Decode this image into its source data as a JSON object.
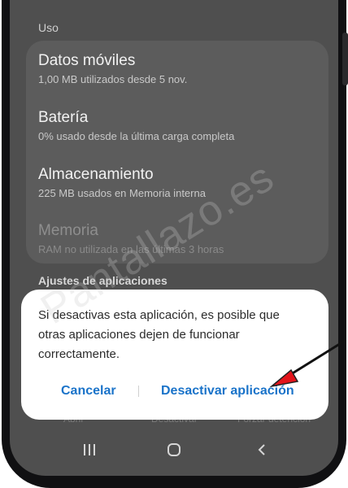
{
  "sections": {
    "usage_label": "Uso",
    "app_settings_label": "Ajustes de aplicaciones"
  },
  "usage_items": [
    {
      "title": "Datos móviles",
      "subtitle": "1,00 MB utilizados desde 5 nov."
    },
    {
      "title": "Batería",
      "subtitle": "0% usado desde la última carga completa"
    },
    {
      "title": "Almacenamiento",
      "subtitle": "225 MB usados en Memoria interna"
    },
    {
      "title": "Memoria",
      "subtitle": "RAM no utilizada en las últimas 3 horas"
    }
  ],
  "background_actions": {
    "open": "Abrir",
    "deactivate": "Desactivar",
    "force_stop": "Forzar detención"
  },
  "dialog": {
    "message": "Si desactivas esta aplicación, es posible que otras aplicaciones dejen de funcionar correctamente.",
    "cancel_label": "Cancelar",
    "deactivate_label": "Desactivar aplicación"
  },
  "navigation": {
    "recents_icon": "recents-icon",
    "home_icon": "home-icon",
    "back_icon": "back-icon"
  },
  "watermark": "Pantallazo.es",
  "colors": {
    "accent": "#1a73c9",
    "dim_background": "#4f4f4f",
    "annotation_arrow": "#e3141b"
  }
}
